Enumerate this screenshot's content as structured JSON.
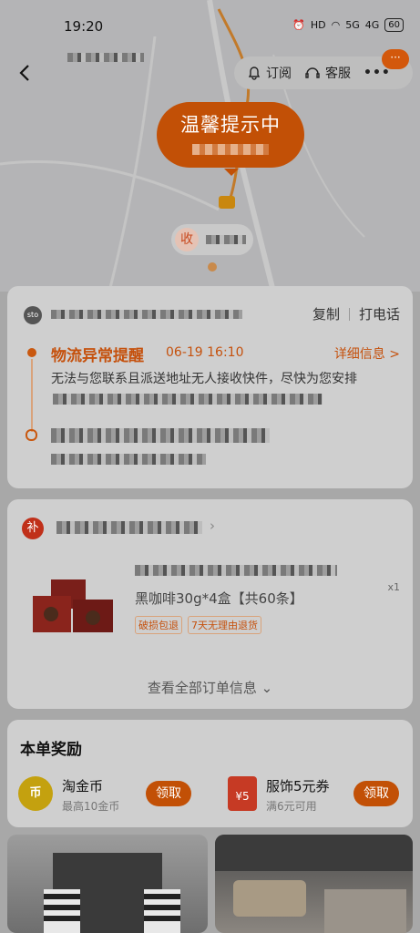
{
  "status": {
    "time": "19:20",
    "battery": "60",
    "net1": "5G",
    "net2": "4G"
  },
  "topbar": {
    "subscribe_label": "订阅",
    "service_label": "客服",
    "more_badge": "···"
  },
  "map": {
    "bubble_title": "温馨提示中",
    "receiver_label": "收"
  },
  "logistics": {
    "carrier_logo": "sto",
    "copy_label": "复制",
    "call_label": "打电话",
    "alert_title": "物流异常提醒",
    "alert_time": "06-19 16:10",
    "detail_label": "详细信息 >",
    "alert_desc": "无法与您联系且派送地址无人接收快件，尽快为您安排"
  },
  "order": {
    "shop_icon_label": "补",
    "product_title": "黑咖啡30g*4盒【共60条】",
    "quantity": "x1",
    "tags": [
      "破损包退",
      "7天无理由退货"
    ],
    "view_all_label": "查看全部订单信息"
  },
  "rewards": {
    "title": "本单奖励",
    "items": [
      {
        "name": "淘金币",
        "sub": "最高10金币",
        "claim": "领取",
        "icon": "coin-icon"
      },
      {
        "name": "服饰5元券",
        "sub": "满6元可用",
        "claim": "领取",
        "icon": "coupon-icon"
      }
    ]
  },
  "colors": {
    "accent": "#c25006"
  }
}
